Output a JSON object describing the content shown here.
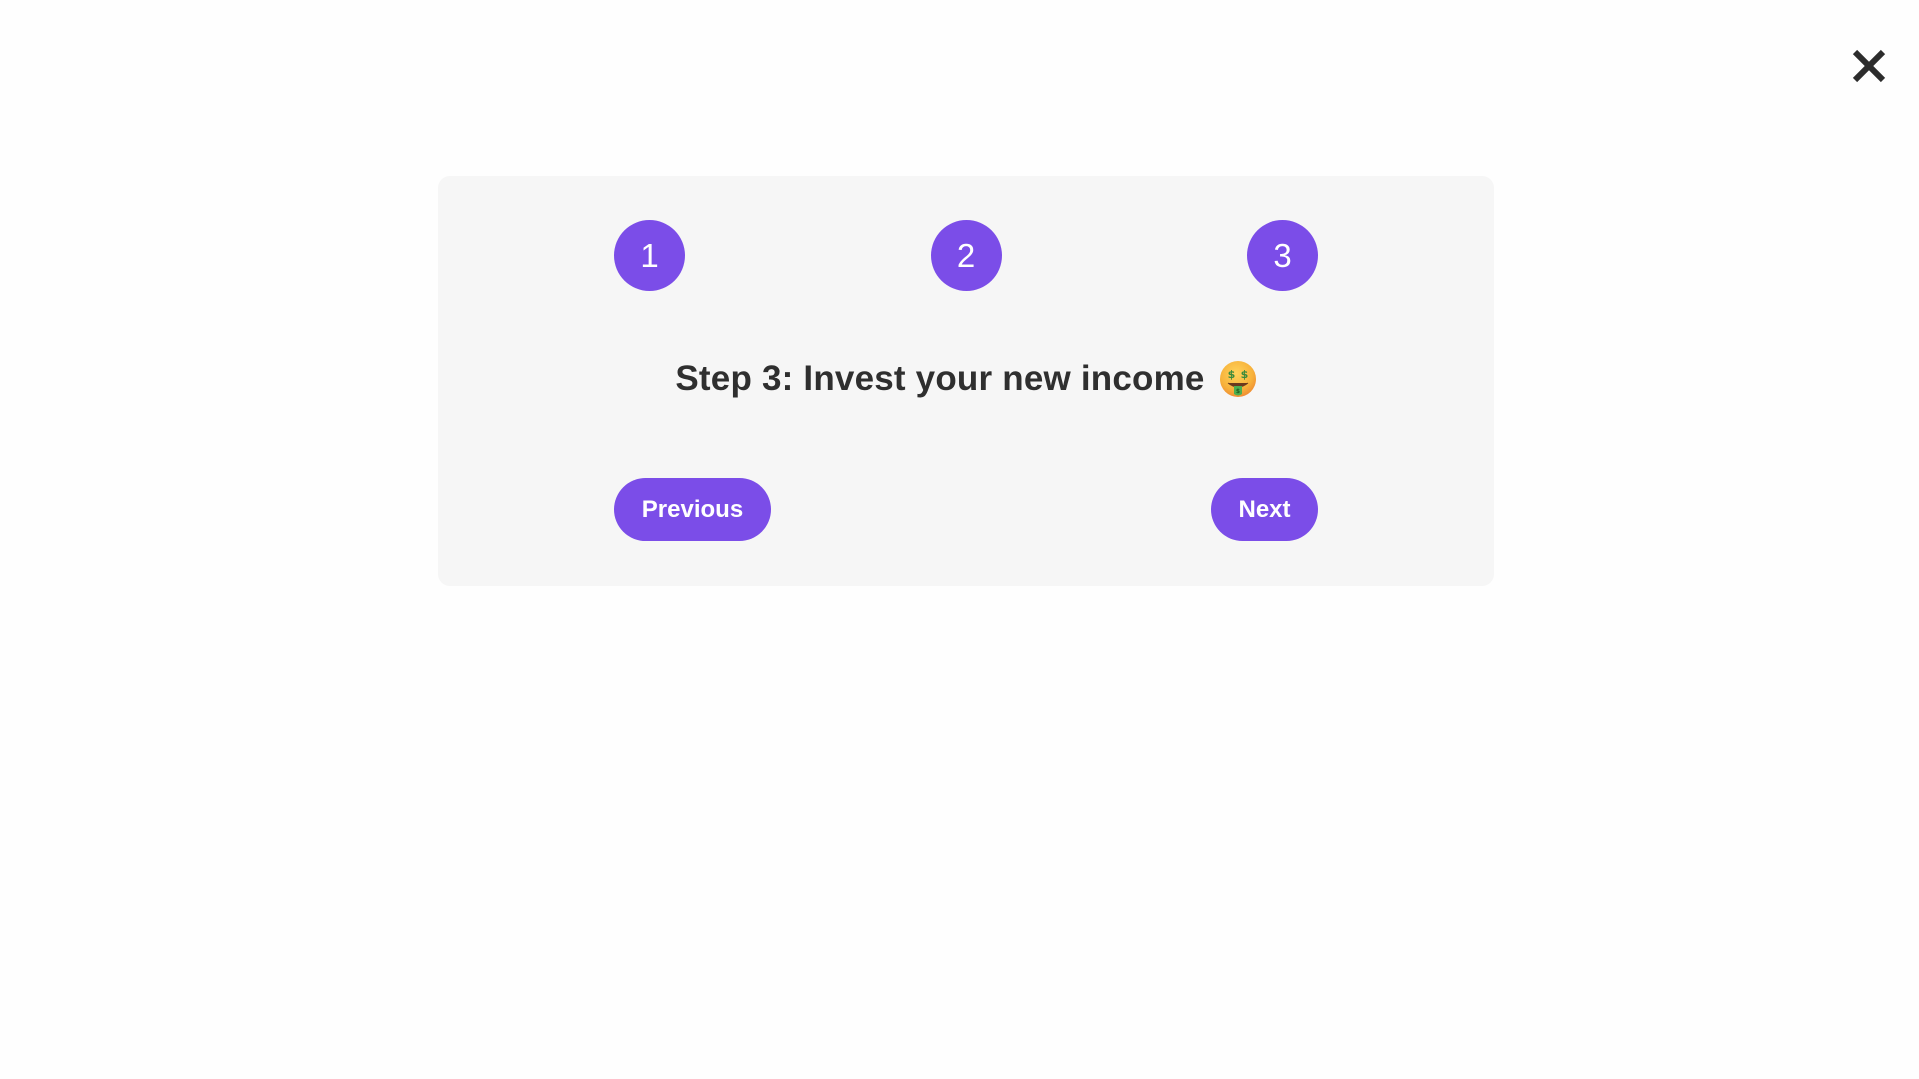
{
  "colors": {
    "accent": "#7b4de8",
    "card_background": "#f6f6f6",
    "title_text": "#2f2f2f",
    "close_icon": "#2c2c2c"
  },
  "close_button": {
    "icon": "close-icon"
  },
  "stepper": {
    "steps": [
      {
        "label": "1"
      },
      {
        "label": "2"
      },
      {
        "label": "3"
      }
    ],
    "current_step": 3
  },
  "content": {
    "title": "Step 3: Invest your new income",
    "title_icon": "money-mouth-face-icon"
  },
  "navigation": {
    "previous_label": "Previous",
    "next_label": "Next"
  }
}
